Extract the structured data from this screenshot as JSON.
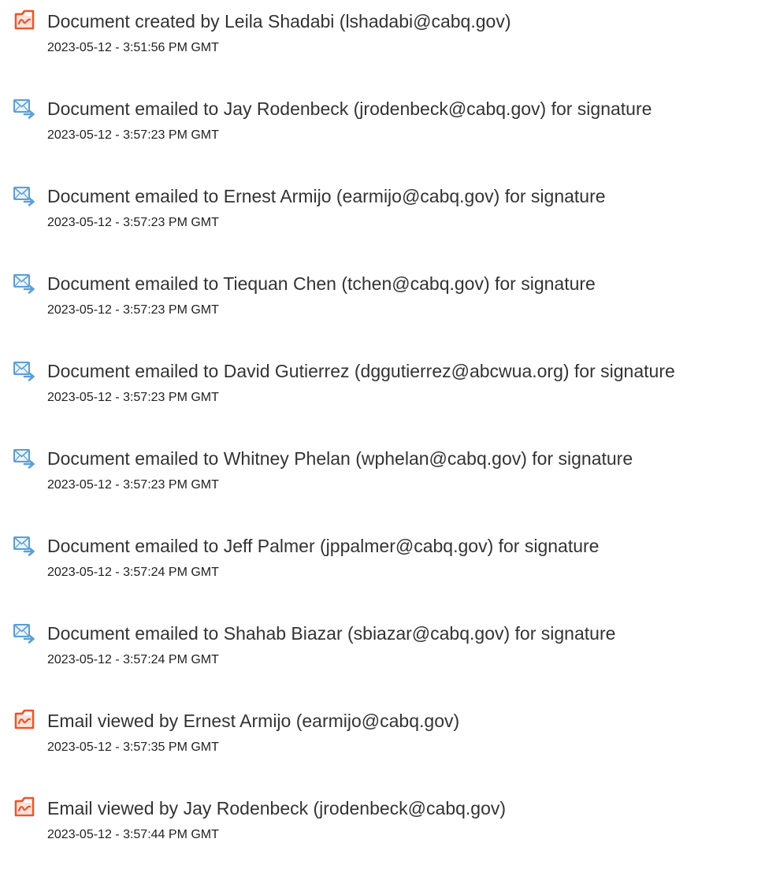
{
  "colors": {
    "doc_icon": "#e8572b",
    "email_icon": "#5a9fd6",
    "text": "#333333"
  },
  "history": [
    {
      "icon": "document-icon",
      "text": "Document created by Leila Shadabi (lshadabi@cabq.gov)",
      "timestamp": "2023-05-12 - 3:51:56 PM GMT"
    },
    {
      "icon": "email-sent-icon",
      "text": "Document emailed to Jay Rodenbeck (jrodenbeck@cabq.gov) for signature",
      "timestamp": "2023-05-12 - 3:57:23 PM GMT"
    },
    {
      "icon": "email-sent-icon",
      "text": "Document emailed to Ernest Armijo (earmijo@cabq.gov) for signature",
      "timestamp": "2023-05-12 - 3:57:23 PM GMT"
    },
    {
      "icon": "email-sent-icon",
      "text": "Document emailed to Tiequan Chen (tchen@cabq.gov) for signature",
      "timestamp": "2023-05-12 - 3:57:23 PM GMT"
    },
    {
      "icon": "email-sent-icon",
      "text": "Document emailed to David Gutierrez (dggutierrez@abcwua.org) for signature",
      "timestamp": "2023-05-12 - 3:57:23 PM GMT"
    },
    {
      "icon": "email-sent-icon",
      "text": "Document emailed to Whitney Phelan (wphelan@cabq.gov) for signature",
      "timestamp": "2023-05-12 - 3:57:23 PM GMT"
    },
    {
      "icon": "email-sent-icon",
      "text": "Document emailed to Jeff Palmer (jppalmer@cabq.gov) for signature",
      "timestamp": "2023-05-12 - 3:57:24 PM GMT"
    },
    {
      "icon": "email-sent-icon",
      "text": "Document emailed to Shahab Biazar (sbiazar@cabq.gov) for signature",
      "timestamp": "2023-05-12 - 3:57:24 PM GMT"
    },
    {
      "icon": "document-icon",
      "text": "Email viewed by Ernest Armijo (earmijo@cabq.gov)",
      "timestamp": "2023-05-12 - 3:57:35 PM GMT"
    },
    {
      "icon": "document-icon",
      "text": "Email viewed by Jay Rodenbeck (jrodenbeck@cabq.gov)",
      "timestamp": "2023-05-12 - 3:57:44 PM GMT"
    }
  ]
}
